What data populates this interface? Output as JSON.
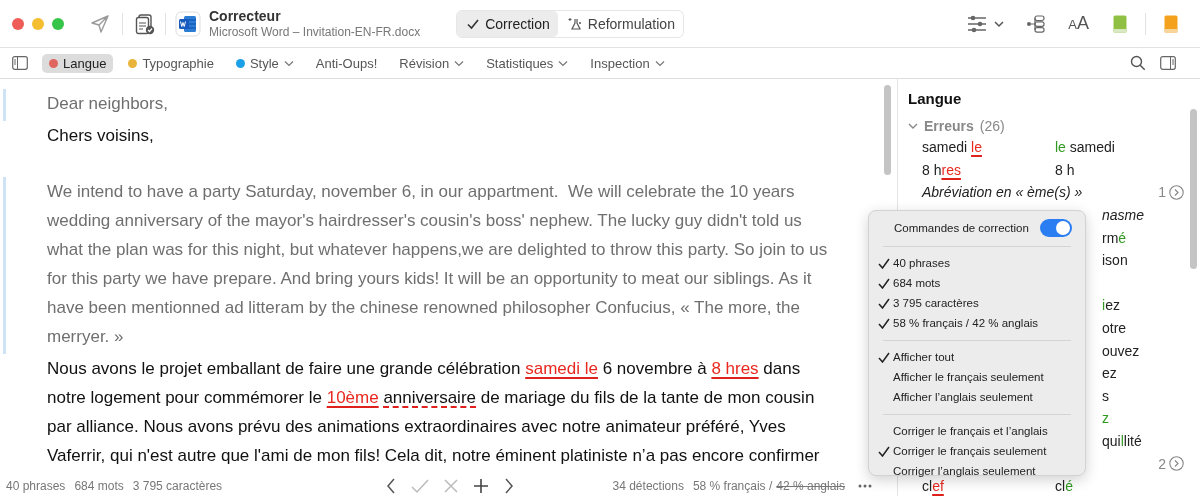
{
  "window": {
    "title": "Correcteur",
    "subtitle": "Microsoft Word – Invitation-EN-FR.docx"
  },
  "modes": [
    {
      "label": "Correction",
      "selected": true
    },
    {
      "label": "Reformulation",
      "selected": false
    }
  ],
  "text_size_glyph": "AA",
  "tabs": [
    {
      "label": "Langue",
      "color": "#e0675f",
      "selected": true,
      "menu": false
    },
    {
      "label": "Typographie",
      "color": "#e8b43a",
      "selected": false,
      "menu": false
    },
    {
      "label": "Style",
      "color": "#1b9fe6",
      "selected": false,
      "menu": true
    },
    {
      "label": "Anti-Oups!",
      "selected": false,
      "menu": false
    },
    {
      "label": "Révision",
      "selected": false,
      "menu": true
    },
    {
      "label": "Statistiques",
      "selected": false,
      "menu": true
    },
    {
      "label": "Inspection",
      "selected": false,
      "menu": true
    }
  ],
  "document": {
    "blocks": [
      [
        {
          "kind": "english",
          "lines": [
            [
              {
                "text": "Dear neighbors,"
              }
            ]
          ]
        },
        {
          "kind": "french",
          "lines": [
            [
              {
                "text": "Chers voisins,"
              }
            ]
          ]
        }
      ],
      [
        {
          "kind": "english",
          "lines": [
            [
              {
                "text": "We intend to have a party Saturday, november 6, in our appartment.  We will celebrate the 10 years"
              }
            ],
            [
              {
                "text": "wedding anniversary of the mayor's hairdresser's cousin's boss' nephew. The lucky guy didn't told us"
              }
            ],
            [
              {
                "text": "what the plan was for this night, but whatever happens,we are delighted to throw this party. So join to us"
              }
            ],
            [
              {
                "text": "for this party we have prepare. And bring yours kids! It will be an opportunity to meat our siblings. As it"
              }
            ],
            [
              {
                "text": "have been mentionned ad litteram by the chinese renowned philosopher Confucius, « The more, the"
              }
            ],
            [
              {
                "text": "merryer. »"
              }
            ]
          ]
        },
        {
          "kind": "french",
          "lines": [
            [
              {
                "text": "Nous avons le projet emballant de faire une grande célébration "
              },
              {
                "text": "samedi le",
                "kind": "error"
              },
              {
                "text": " 6 novembre à "
              },
              {
                "text": "8 hres",
                "kind": "error"
              },
              {
                "text": " dans"
              }
            ],
            [
              {
                "text": "notre logement pour commémorer le "
              },
              {
                "text": "10ème",
                "kind": "error"
              },
              {
                "text": " anniversaire",
                "kind": "style"
              },
              {
                "text": " de mariage du fils de la tante de mon cousin"
              }
            ],
            [
              {
                "text": "par alliance. Nous avons prévu des animations extraordinaires avec notre animateur préféré, Yves"
              }
            ],
            [
              {
                "text": "Vaferrir, qui n'est autre que l'ami de mon fils! Cela dit, notre éminent platiniste n’a pas encore confirmer"
              }
            ]
          ]
        }
      ]
    ]
  },
  "status_bar": {
    "counts": [
      "40 phrases",
      "684 mots",
      "3 795 caractères"
    ],
    "detections": "34 détections",
    "languages": [
      {
        "text": "58 % français /",
        "disabled": false
      },
      {
        "text": "42 % anglais",
        "disabled": true
      }
    ]
  },
  "sidebar": {
    "title": "Langue",
    "group": {
      "label": "Erreurs",
      "count": "(26)",
      "expanded": true,
      "rows": [
        {
          "kind": "pair",
          "left": [
            {
              "text": "samedi "
            },
            {
              "text": "le",
              "kind": "error"
            }
          ],
          "right": [
            {
              "text": "le",
              "kind": "fix"
            },
            {
              "text": " samedi"
            }
          ]
        },
        {
          "kind": "pair",
          "left": [
            {
              "text": "8 h"
            },
            {
              "text": "res",
              "kind": "error"
            }
          ],
          "right": [
            {
              "text": "8 h"
            }
          ]
        },
        {
          "kind": "rule",
          "label": "Abréviation en « ème(s) »",
          "count": "1"
        },
        {
          "kind": "partial",
          "parts": [
            {
              "text": "nasme",
              "kind": "rule"
            }
          ]
        },
        {
          "kind": "partial",
          "parts": [
            {
              "text": "rm"
            },
            {
              "text": "é",
              "kind": "fix"
            }
          ]
        },
        {
          "kind": "partial",
          "parts": [
            {
              "text": "ison"
            }
          ]
        },
        {
          "kind": "covered"
        },
        {
          "kind": "partial",
          "parts": [
            {
              "text": "i",
              "kind": "fix"
            },
            {
              "text": "ez"
            }
          ]
        },
        {
          "kind": "partial",
          "parts": [
            {
              "text": "otre"
            }
          ]
        },
        {
          "kind": "partial",
          "parts": [
            {
              "text": "ouvez"
            }
          ]
        },
        {
          "kind": "partial",
          "parts": [
            {
              "text": "ez"
            }
          ]
        },
        {
          "kind": "partial",
          "parts": [
            {
              "text": "s"
            }
          ]
        },
        {
          "kind": "partial",
          "parts": [
            {
              "text": "z",
              "kind": "fix"
            }
          ]
        },
        {
          "kind": "partial",
          "parts": [
            {
              "text": "qui"
            },
            {
              "text": "l",
              "kind": "fix"
            },
            {
              "text": "lité"
            }
          ]
        },
        {
          "kind": "count",
          "count": "2"
        },
        {
          "kind": "pair",
          "left": [
            {
              "text": "cl"
            },
            {
              "text": "ef",
              "kind": "error"
            }
          ],
          "right": [
            {
              "text": "cl"
            },
            {
              "text": "é",
              "kind": "fix"
            }
          ]
        }
      ]
    }
  },
  "popup": {
    "toggle": {
      "label": "Commandes de correction",
      "on": true
    },
    "groups": [
      [
        {
          "label": "40 phrases",
          "checked": true
        },
        {
          "label": "684 mots",
          "checked": true
        },
        {
          "label": "3 795 caractères",
          "checked": true
        },
        {
          "label": "58 % français / 42 % anglais",
          "checked": true
        }
      ],
      [
        {
          "label": "Afficher tout",
          "checked": true
        },
        {
          "label": "Afficher le français seulement",
          "checked": false
        },
        {
          "label": "Afficher l’anglais seulement",
          "checked": false
        }
      ],
      [
        {
          "label": "Corriger le français et l’anglais",
          "checked": false
        },
        {
          "label": "Corriger le français seulement",
          "checked": true
        },
        {
          "label": "Corriger l’anglais seulement",
          "checked": false
        }
      ]
    ]
  }
}
